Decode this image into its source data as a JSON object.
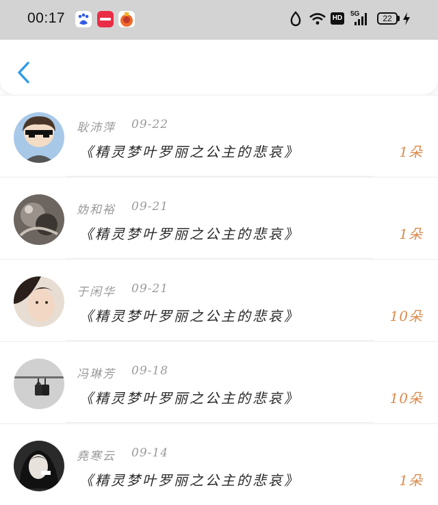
{
  "status_bar": {
    "time": "00:17",
    "app_icons": [
      "baidu-icon",
      "xiaohongshu-icon",
      "taobao-icon"
    ],
    "system_icons": [
      "do-not-disturb-icon",
      "wifi-icon",
      "hd-icon",
      "signal-5g-icon",
      "battery-icon",
      "charging-icon"
    ],
    "hd_label": "HD",
    "network_label": "5G",
    "battery_level": "22"
  },
  "header": {
    "back_icon": "chevron-left-icon",
    "accent_color": "#2b9be8"
  },
  "rows": [
    {
      "name": "耿沛萍",
      "date": "09-22",
      "book": "《精灵梦叶罗丽之公主的悲哀》",
      "count": "1朵"
    },
    {
      "name": "妫和裕",
      "date": "09-21",
      "book": "《精灵梦叶罗丽之公主的悲哀》",
      "count": "1朵"
    },
    {
      "name": "于闲华",
      "date": "09-21",
      "book": "《精灵梦叶罗丽之公主的悲哀》",
      "count": "10朵"
    },
    {
      "name": "冯琳芳",
      "date": "09-18",
      "book": "《精灵梦叶罗丽之公主的悲哀》",
      "count": "10朵"
    },
    {
      "name": "堯寒云",
      "date": "09-14",
      "book": "《精灵梦叶罗丽之公主的悲哀》",
      "count": "1朵"
    }
  ],
  "colors": {
    "count_color": "#d98a4b",
    "name_color": "#9a9a9a",
    "status_bar_bg": "#d3d3d3"
  }
}
